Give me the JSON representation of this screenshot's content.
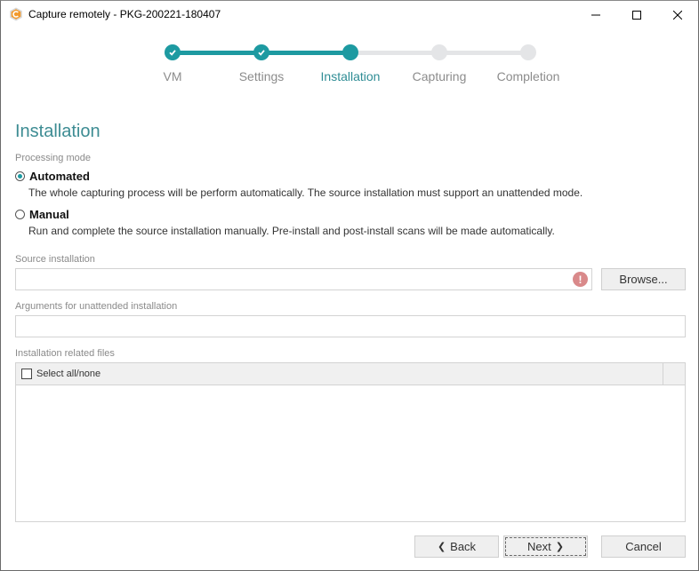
{
  "window": {
    "title": "Capture remotely - PKG-200221-180407",
    "icon": "app-logo-icon",
    "controls": [
      "minimize-icon",
      "maximize-icon",
      "close-icon"
    ]
  },
  "stepper": {
    "accent_color": "#1d9aa1",
    "inactive_color": "#e4e5e7",
    "current_index": 2,
    "steps": [
      {
        "label": "VM",
        "state": "done"
      },
      {
        "label": "Settings",
        "state": "done"
      },
      {
        "label": "Installation",
        "state": "current"
      },
      {
        "label": "Capturing",
        "state": "pending"
      },
      {
        "label": "Completion",
        "state": "pending"
      }
    ]
  },
  "page": {
    "title": "Installation",
    "processing_mode": {
      "label": "Processing mode",
      "selected": "Automated",
      "options": [
        {
          "label": "Automated",
          "description": "The whole capturing process will be perform automatically. The source installation must support an unattended mode."
        },
        {
          "label": "Manual",
          "description": "Run and complete the source installation manually. Pre-install and post-install scans will be made automatically."
        }
      ]
    },
    "source_installation": {
      "label": "Source installation",
      "value": "",
      "validation": "error",
      "browse_label": "Browse..."
    },
    "arguments": {
      "label": "Arguments for unattended installation",
      "value": ""
    },
    "related_files": {
      "label": "Installation related files",
      "select_all_label": "Select all/none",
      "select_all_checked": false,
      "rows": []
    }
  },
  "footer": {
    "back_label": "Back",
    "next_label": "Next",
    "cancel_label": "Cancel"
  }
}
